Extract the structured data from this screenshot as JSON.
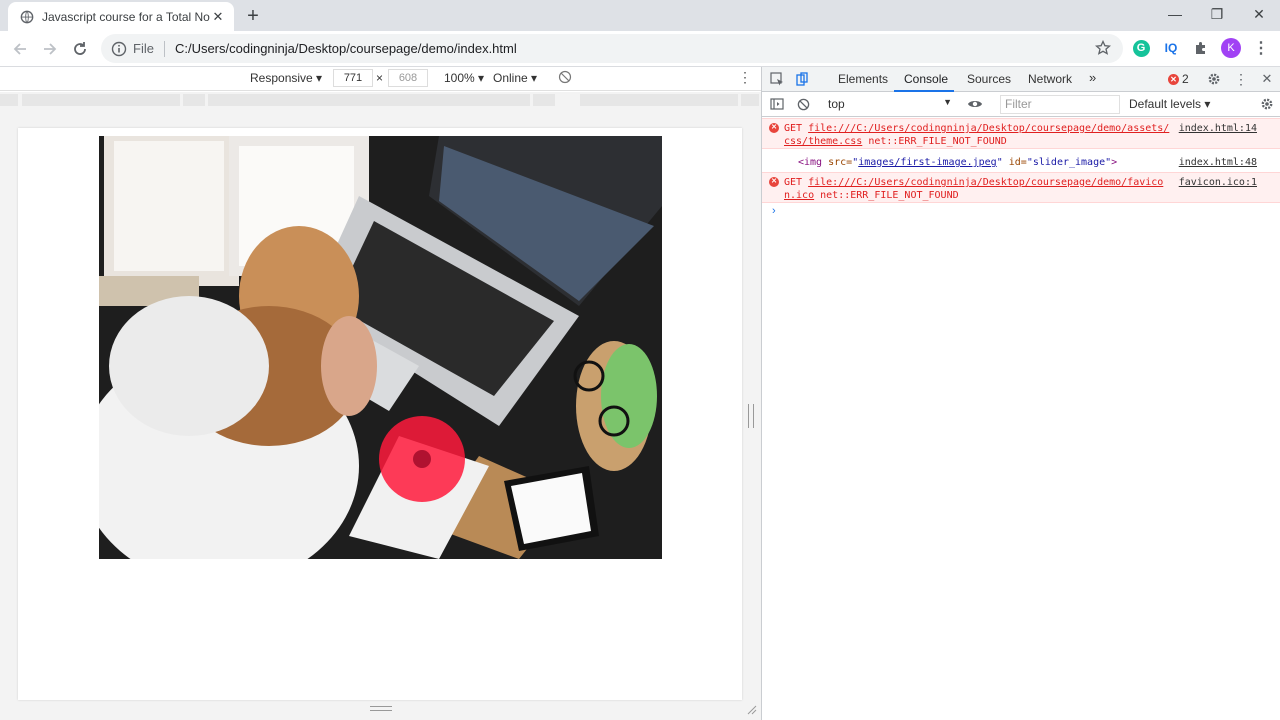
{
  "browser": {
    "tab_title": "Javascript course for a Total Novi",
    "url_scheme": "File",
    "url": "C:/Users/codingninja/Desktop/coursepage/demo/index.html",
    "profile_initial": "K",
    "ext_iq": "IQ",
    "ext_grammarly": "G"
  },
  "device_toolbar": {
    "device": "Responsive ▾",
    "width": "771",
    "times": "×",
    "height": "608",
    "zoom": "100% ▾",
    "network": "Online ▾"
  },
  "devtools": {
    "tabs": [
      "Elements",
      "Console",
      "Sources",
      "Network"
    ],
    "more_tabs": "»",
    "error_count": "2",
    "context": "top",
    "filter_placeholder": "Filter",
    "levels": "Default levels ▾"
  },
  "console": {
    "messages": [
      {
        "method": "GET",
        "url": "file:///C:/Users/codingninja/Desktop/coursepage/demo/assets/css/theme.css",
        "error": "net::ERR_FILE_NOT_FOUND",
        "source": "index.html:14"
      },
      {
        "tag_open": "<img ",
        "attr_src": "src=",
        "src_value": "images/first-image.jpeg",
        "attr_id": " id=",
        "id_value": "\"slider_image\"",
        "tag_close": ">",
        "source": "index.html:48"
      },
      {
        "method": "GET",
        "url": "file:///C:/Users/codingninja/Desktop/coursepage/demo/favicon.ico",
        "error": "net::ERR_FILE_NOT_FOUND",
        "source": "favicon.ico:1"
      }
    ],
    "prompt": "›"
  },
  "colors": {
    "accent": "#1a73e8",
    "error": "#e02020",
    "grammarly": "#15c39a",
    "profile": "#a142f4"
  }
}
